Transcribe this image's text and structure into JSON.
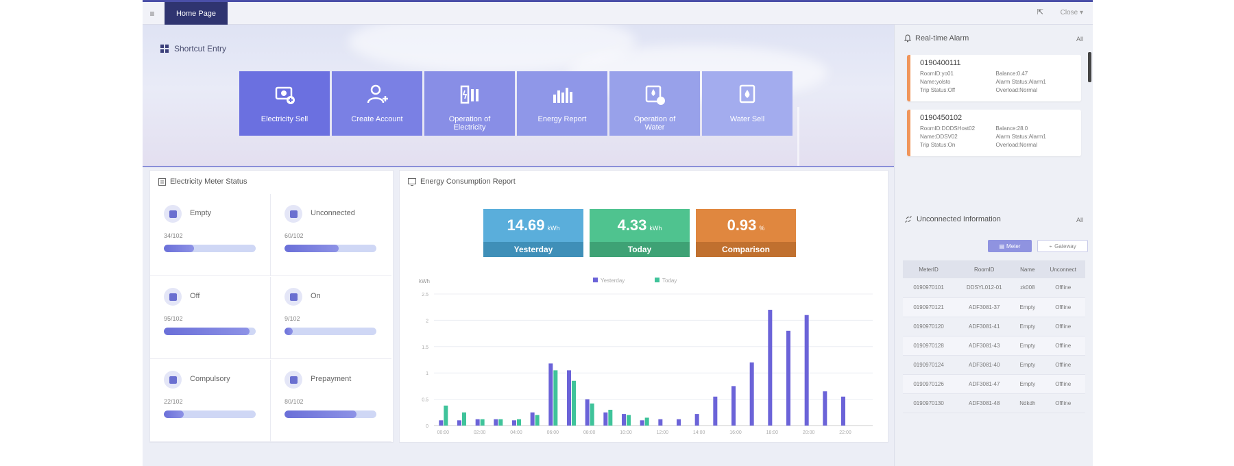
{
  "topbar": {
    "home_tab": "Home Page",
    "menu_icon": "menu-icon",
    "close_label": "Close"
  },
  "shortcut": {
    "title": "Shortcut Entry",
    "tiles": [
      {
        "label": "Electricity Sell",
        "color": "#6b70e0",
        "icon": "electricity-sell-icon"
      },
      {
        "label": "Create Account",
        "color": "#7a80e4",
        "icon": "create-account-icon"
      },
      {
        "label": "Operation of Electricity",
        "color": "#888ee6",
        "icon": "operation-electricity-icon"
      },
      {
        "label": "Energy Report",
        "color": "#8f97e8",
        "icon": "energy-report-icon"
      },
      {
        "label": "Operation of Water",
        "color": "#98a1ea",
        "icon": "operation-water-icon"
      },
      {
        "label": "Water Sell",
        "color": "#a3acee",
        "icon": "water-sell-icon"
      }
    ]
  },
  "meter_status": {
    "title": "Electricity Meter Status",
    "cells": [
      {
        "label": "Empty",
        "count": "34/102",
        "fraction": 0.33
      },
      {
        "label": "Unconnected",
        "count": "60/102",
        "fraction": 0.59
      },
      {
        "label": "Off",
        "count": "95/102",
        "fraction": 0.93
      },
      {
        "label": "On",
        "count": "9/102",
        "fraction": 0.09
      },
      {
        "label": "Compulsory",
        "count": "22/102",
        "fraction": 0.22
      },
      {
        "label": "Prepayment",
        "count": "80/102",
        "fraction": 0.78
      }
    ]
  },
  "report": {
    "title": "Energy Consumption Report",
    "stats": [
      {
        "value": "14.69",
        "unit": "kWh",
        "label": "Yesterday",
        "color": "#5aaedb",
        "label_bg": "#3f8fb8"
      },
      {
        "value": "4.33",
        "unit": "kWh",
        "label": "Today",
        "color": "#4fc38f",
        "label_bg": "#3ea275"
      },
      {
        "value": "0.93",
        "unit": "%",
        "label": "Comparison",
        "color": "#e0873f",
        "label_bg": "#c0702f"
      }
    ]
  },
  "chart_data": {
    "type": "bar",
    "ylabel": "kWh",
    "ylim": [
      0,
      2.5
    ],
    "yticks": [
      "0",
      "0.5",
      "1",
      "1.5",
      "2",
      "2.5"
    ],
    "xticks": [
      "00:00",
      "02:00",
      "04:00",
      "06:00",
      "08:00",
      "10:00",
      "12:00",
      "14:00",
      "16:00",
      "18:00",
      "20:00",
      "22:00"
    ],
    "categories": [
      "00",
      "01",
      "02",
      "03",
      "04",
      "05",
      "06",
      "07",
      "08",
      "09",
      "10",
      "11",
      "12",
      "13",
      "14",
      "15",
      "16",
      "17",
      "18",
      "19",
      "20",
      "21",
      "22",
      "23"
    ],
    "series": [
      {
        "name": "Yesterday",
        "color": "#6b63d8",
        "values": [
          0.1,
          0.1,
          0.12,
          0.12,
          0.1,
          0.25,
          1.18,
          1.05,
          0.5,
          0.25,
          0.22,
          0.1,
          0.12,
          0.12,
          0.22,
          0.55,
          0.75,
          1.2,
          2.2,
          1.8,
          2.1,
          0.65,
          0.55,
          0
        ]
      },
      {
        "name": "Today",
        "color": "#3fc39a",
        "values": [
          0.38,
          0.25,
          0.12,
          0.12,
          0.12,
          0.2,
          1.05,
          0.85,
          0.42,
          0.3,
          0.2,
          0.15,
          0,
          0,
          0,
          0,
          0,
          0,
          0,
          0,
          0,
          0,
          0,
          0
        ]
      }
    ],
    "legend": "top-center",
    "grid": true
  },
  "alarm": {
    "title": "Real-time Alarm",
    "all_label": "All",
    "items": [
      {
        "id": "0190400111",
        "rows": [
          [
            "RoomID:yo01",
            "Balance:0.47"
          ],
          [
            "Name:yolsto",
            "Alarm Status:Alarm1"
          ],
          [
            "Trip Status:Off",
            "Overload:Normal"
          ]
        ]
      },
      {
        "id": "0190450102",
        "rows": [
          [
            "RoomID:DODSHost02",
            "Balance:28.0"
          ],
          [
            "Name:DDSV02",
            "Alarm Status:Alarm1"
          ],
          [
            "Trip Status:On",
            "Overload:Normal"
          ]
        ]
      }
    ]
  },
  "unconnected": {
    "title": "Unconnected Information",
    "all_label": "All",
    "btn_meter": "Meter",
    "btn_gateway": "Gateway",
    "headers": [
      "MeterID",
      "RoomID",
      "Name",
      "Unconnect"
    ],
    "rows": [
      [
        "0190970101",
        "DDSYL012-01",
        "zk008",
        "Offline"
      ],
      [
        "0190970121",
        "ADF3081-37",
        "Empty",
        "Offline"
      ],
      [
        "0190970120",
        "ADF3081-41",
        "Empty",
        "Offline"
      ],
      [
        "0190970128",
        "ADF3081-43",
        "Empty",
        "Offline"
      ],
      [
        "0190970124",
        "ADF3081-40",
        "Empty",
        "Offline"
      ],
      [
        "0190970126",
        "ADF3081-47",
        "Empty",
        "Offline"
      ],
      [
        "0190970130",
        "ADF3081-48",
        "Ndkdh",
        "Offline"
      ]
    ]
  }
}
